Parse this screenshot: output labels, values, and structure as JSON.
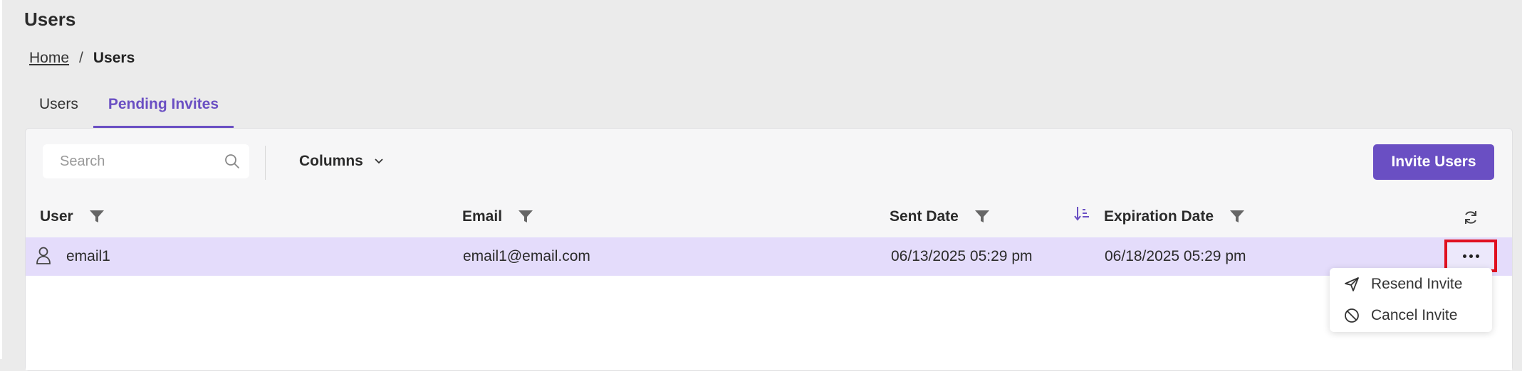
{
  "page": {
    "title": "Users"
  },
  "breadcrumb": {
    "home": "Home",
    "separator": "/",
    "current": "Users"
  },
  "tabs": [
    {
      "label": "Users",
      "active": false
    },
    {
      "label": "Pending Invites",
      "active": true
    }
  ],
  "toolbar": {
    "search_placeholder": "Search",
    "columns_label": "Columns",
    "invite_label": "Invite Users"
  },
  "table": {
    "headers": {
      "user": "User",
      "email": "Email",
      "sent_date": "Sent Date",
      "expiration_date": "Expiration Date"
    },
    "rows": [
      {
        "user": "email1",
        "email": "email1@email.com",
        "sent_date": "06/13/2025 05:29 pm",
        "expiration_date": "06/18/2025 05:29 pm"
      }
    ]
  },
  "row_menu": {
    "resend": "Resend Invite",
    "cancel": "Cancel Invite"
  },
  "colors": {
    "accent": "#6a4fc3",
    "row_highlight": "#e4dcfb",
    "annotation": "#e01020"
  },
  "icons": [
    "search-icon",
    "chevron-down-icon",
    "filter-icon",
    "sort-icon",
    "refresh-icon",
    "user-icon",
    "more-icon",
    "send-icon",
    "cancel-icon"
  ]
}
